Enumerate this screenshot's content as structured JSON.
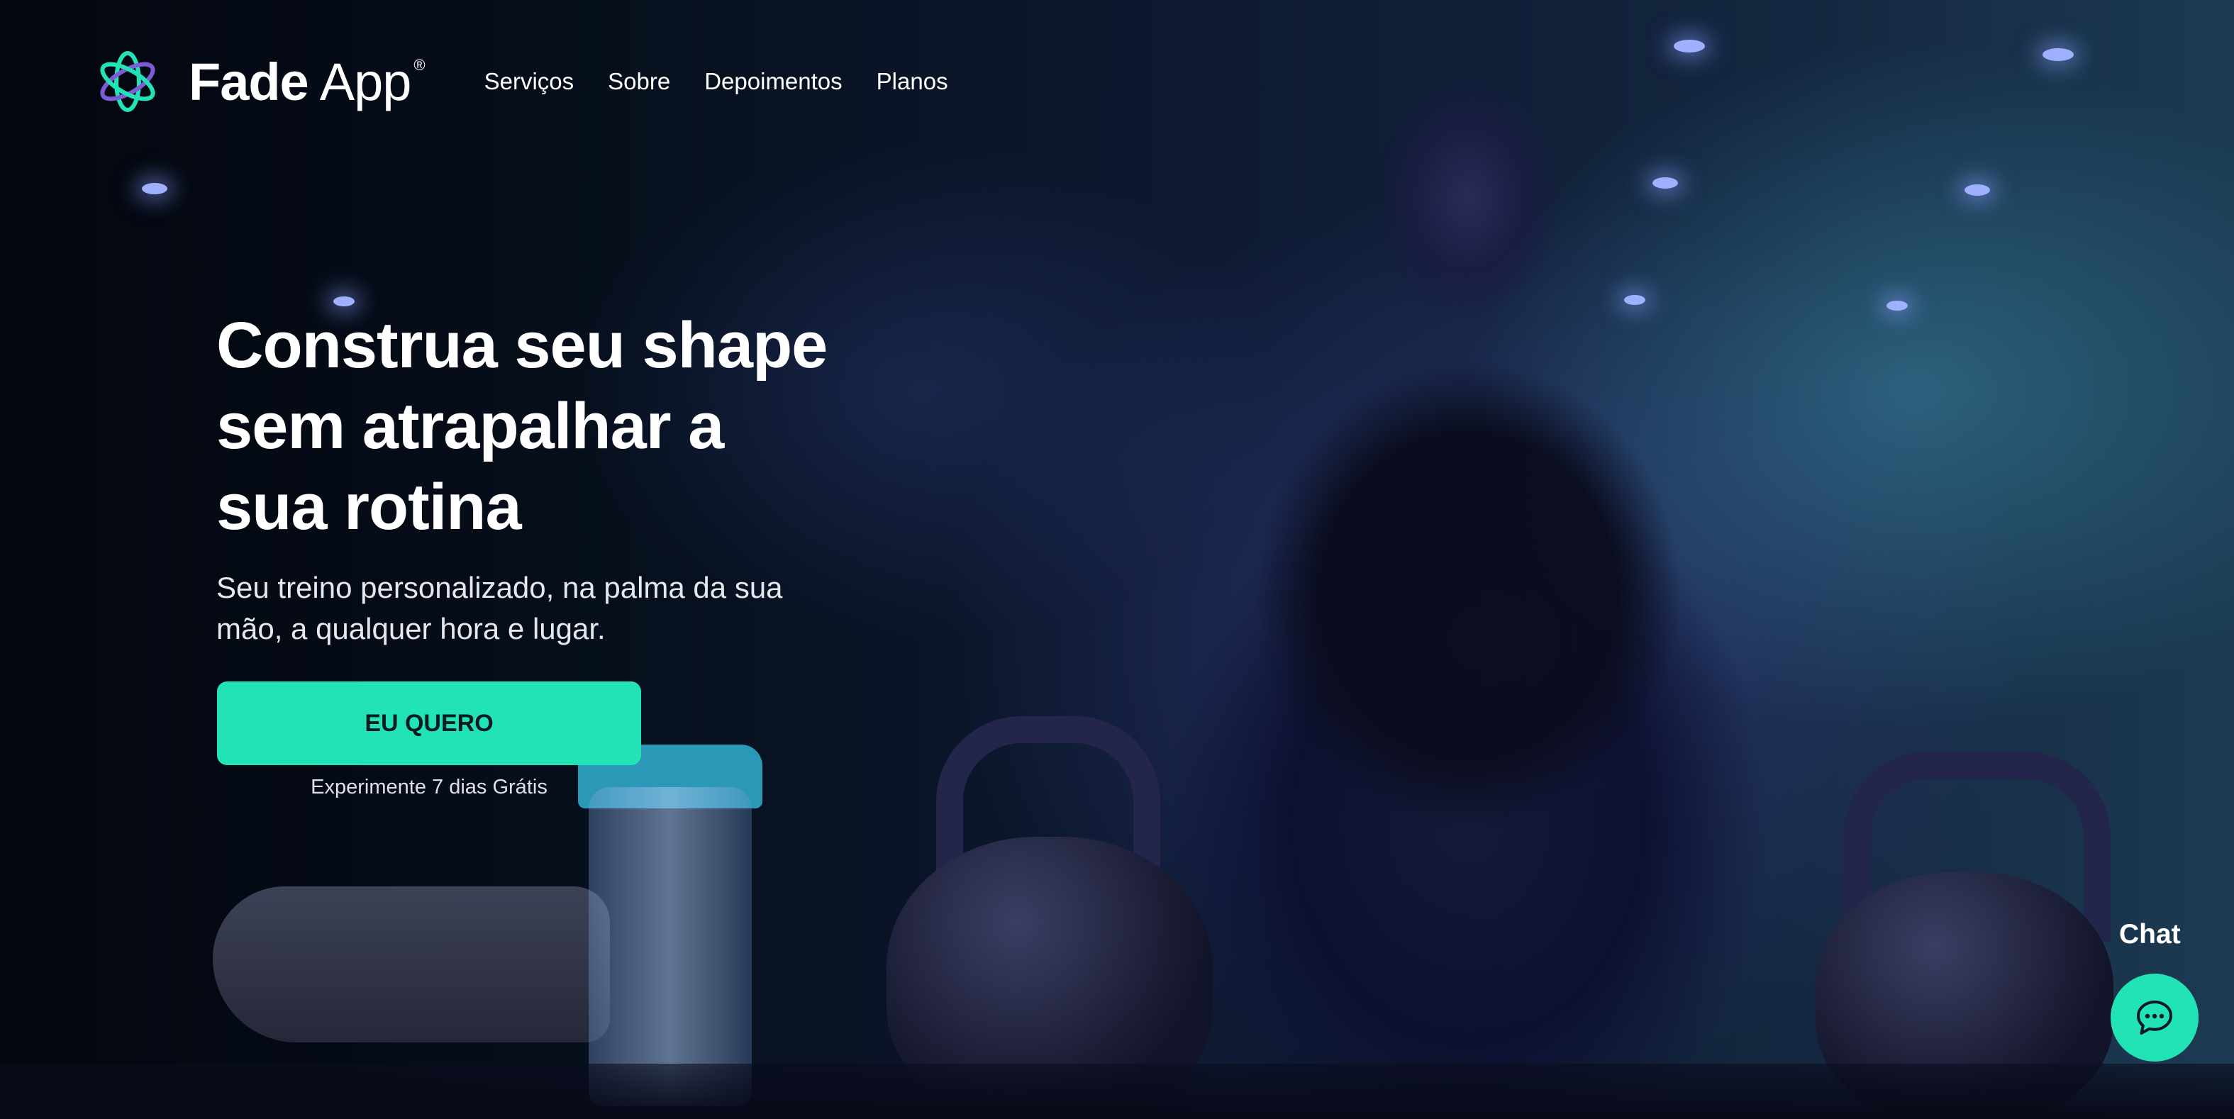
{
  "brand": {
    "name_bold": "Fade",
    "name_regular": "App",
    "registered_mark": "®",
    "logo_icon": "atom-flower-icon",
    "accent_color": "#22e3b6",
    "logo_secondary_color": "#7b5cd6"
  },
  "nav": {
    "items": [
      {
        "label": "Serviços"
      },
      {
        "label": "Sobre"
      },
      {
        "label": "Depoimentos"
      },
      {
        "label": "Planos"
      }
    ]
  },
  "hero": {
    "title_lines": [
      "Construa seu shape",
      "sem atrapalhar a",
      "sua rotina"
    ],
    "subtitle_lines": [
      "Seu treino personalizado, na palma da sua",
      "mão, a qualquer hora e lugar."
    ],
    "cta_label": "EU QUERO",
    "trial_note": "Experimente 7 dias Grátis",
    "background_image": "woman-with-kettlebells-gym-photo"
  },
  "chat": {
    "label": "Chat",
    "icon": "chat-bubble-icon"
  }
}
